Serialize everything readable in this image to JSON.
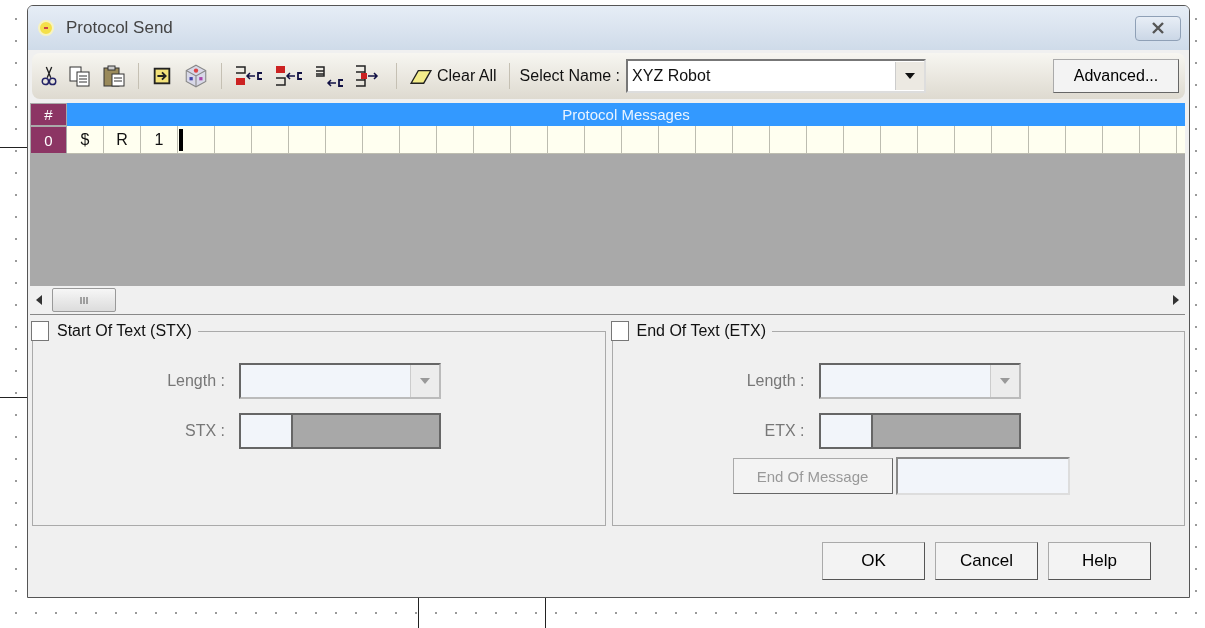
{
  "window": {
    "title": "Protocol Send"
  },
  "toolbar": {
    "clear_all": "Clear All",
    "select_name_label": "Select Name :",
    "select_name_value": "XYZ Robot",
    "advanced": "Advanced..."
  },
  "grid": {
    "index_header": "#",
    "header": "Protocol Messages",
    "rows": [
      {
        "index": "0",
        "cells": [
          "$",
          "R",
          "1"
        ]
      }
    ]
  },
  "groups": [
    {
      "title": "Start Of Text (STX)",
      "checked": false,
      "length_label": "Length :",
      "code_label": "STX :"
    },
    {
      "title": "End Of Text (ETX)",
      "checked": false,
      "length_label": "Length :",
      "code_label": "ETX :",
      "end_of_message": "End Of Message"
    }
  ],
  "buttons": [
    "OK",
    "Cancel",
    "Help"
  ]
}
